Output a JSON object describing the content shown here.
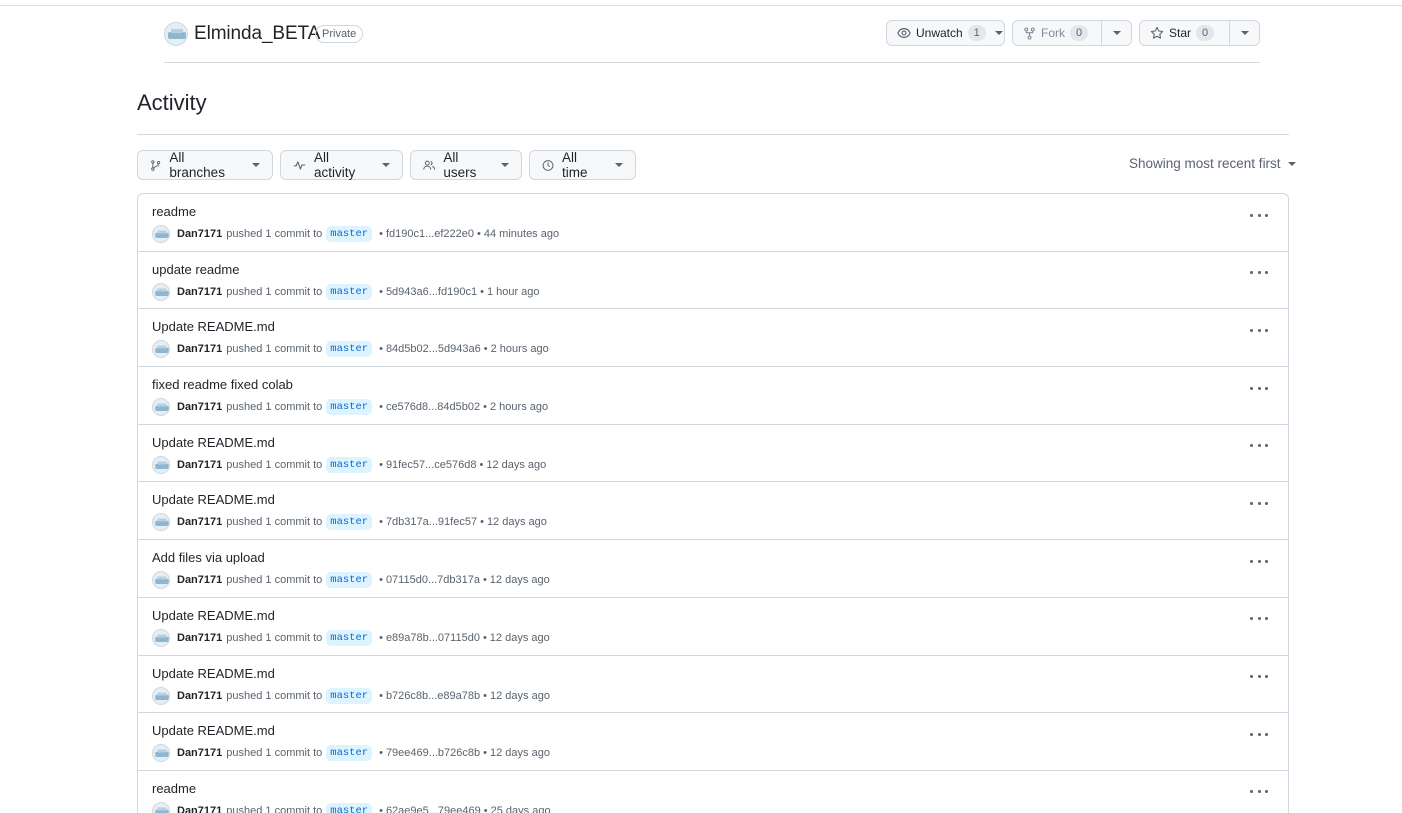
{
  "repo": {
    "name": "Elminda_BETA",
    "visibility": "Private",
    "watch": {
      "label": "Unwatch",
      "count": "1"
    },
    "fork": {
      "label": "Fork",
      "count": "0"
    },
    "star": {
      "label": "Star",
      "count": "0"
    }
  },
  "page": {
    "title": "Activity",
    "filters": {
      "branches": "All branches",
      "activity": "All activity",
      "users": "All users",
      "time": "All time"
    },
    "sort": "Showing most recent first"
  },
  "activity": [
    {
      "title": "readme",
      "user": "Dan7171",
      "action": "pushed 1 commit to",
      "branch": "master",
      "range": "fd190c1...ef222e0",
      "time": "44 minutes ago"
    },
    {
      "title": "update readme",
      "user": "Dan7171",
      "action": "pushed 1 commit to",
      "branch": "master",
      "range": "5d943a6...fd190c1",
      "time": "1 hour ago"
    },
    {
      "title": "Update README.md",
      "user": "Dan7171",
      "action": "pushed 1 commit to",
      "branch": "master",
      "range": "84d5b02...5d943a6",
      "time": "2 hours ago"
    },
    {
      "title": "fixed readme fixed colab",
      "user": "Dan7171",
      "action": "pushed 1 commit to",
      "branch": "master",
      "range": "ce576d8...84d5b02",
      "time": "2 hours ago"
    },
    {
      "title": "Update README.md",
      "user": "Dan7171",
      "action": "pushed 1 commit to",
      "branch": "master",
      "range": "91fec57...ce576d8",
      "time": "12 days ago"
    },
    {
      "title": "Update README.md",
      "user": "Dan7171",
      "action": "pushed 1 commit to",
      "branch": "master",
      "range": "7db317a...91fec57",
      "time": "12 days ago"
    },
    {
      "title": "Add files via upload",
      "user": "Dan7171",
      "action": "pushed 1 commit to",
      "branch": "master",
      "range": "07115d0...7db317a",
      "time": "12 days ago"
    },
    {
      "title": "Update README.md",
      "user": "Dan7171",
      "action": "pushed 1 commit to",
      "branch": "master",
      "range": "e89a78b...07115d0",
      "time": "12 days ago"
    },
    {
      "title": "Update README.md",
      "user": "Dan7171",
      "action": "pushed 1 commit to",
      "branch": "master",
      "range": "b726c8b...e89a78b",
      "time": "12 days ago"
    },
    {
      "title": "Update README.md",
      "user": "Dan7171",
      "action": "pushed 1 commit to",
      "branch": "master",
      "range": "79ee469...b726c8b",
      "time": "12 days ago"
    },
    {
      "title": "readme",
      "user": "Dan7171",
      "action": "pushed 1 commit to",
      "branch": "master",
      "range": "62ae9e5...79ee469",
      "time": "25 days ago"
    }
  ]
}
